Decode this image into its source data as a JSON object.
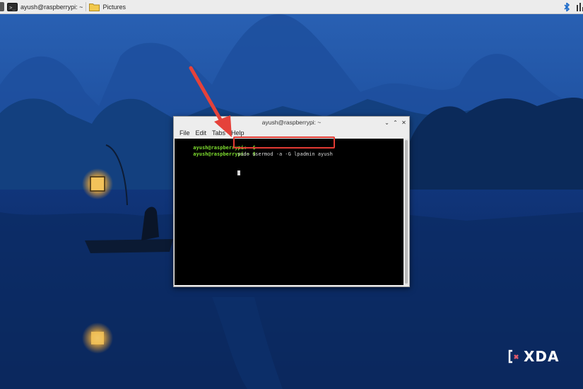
{
  "taskbar": {
    "terminal_task_label": "ayush@raspberrypi: ~",
    "filemanager_task_label": "Pictures"
  },
  "window": {
    "title": "ayush@raspberrypi: ~",
    "menu": [
      "File",
      "Edit",
      "Tabs",
      "Help"
    ],
    "lines": [
      {
        "prompt": "ayush@raspberrypi:~ $",
        "command": "sudo usermod -a -G lpadmin ayush"
      },
      {
        "prompt": "ayush@raspberrypi:~ $",
        "command": ""
      }
    ]
  },
  "watermark": {
    "text": "XDA"
  },
  "colors": {
    "prompt_green": "#7ddc2e",
    "highlight_red": "#e23b33",
    "taskbar_bg": "#ececec",
    "terminal_bg": "#000000"
  }
}
